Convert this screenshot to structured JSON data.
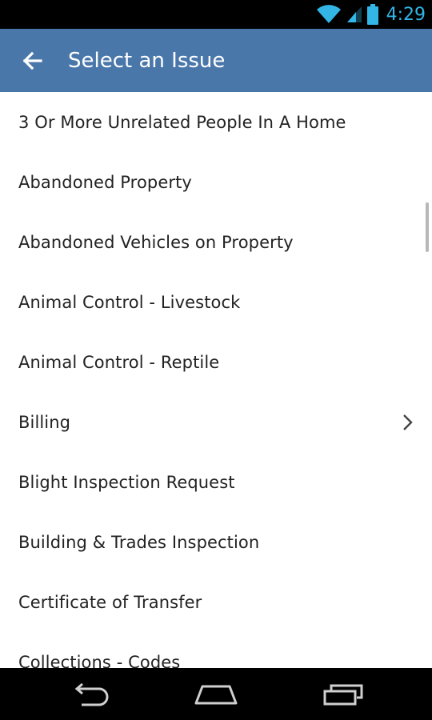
{
  "status_bar": {
    "time": "4:29",
    "icons": [
      "wifi-icon",
      "signal-icon",
      "battery-icon"
    ]
  },
  "app_bar": {
    "title": "Select an Issue",
    "back_icon": "arrow-left-icon",
    "color": "#4a77aa"
  },
  "issues": [
    {
      "label": "3 Or More Unrelated People In A Home",
      "has_children": false
    },
    {
      "label": "Abandoned Property",
      "has_children": false
    },
    {
      "label": "Abandoned Vehicles on Property",
      "has_children": false
    },
    {
      "label": "Animal Control - Livestock",
      "has_children": false
    },
    {
      "label": "Animal Control - Reptile",
      "has_children": false
    },
    {
      "label": "Billing",
      "has_children": true
    },
    {
      "label": "Blight Inspection Request",
      "has_children": false
    },
    {
      "label": "Building & Trades Inspection",
      "has_children": false
    },
    {
      "label": "Certificate of Transfer",
      "has_children": false
    },
    {
      "label": "Collections - Codes",
      "has_children": false
    }
  ],
  "nav_bar": {
    "icons": [
      "back-nav-icon",
      "home-nav-icon",
      "recent-apps-icon"
    ]
  }
}
